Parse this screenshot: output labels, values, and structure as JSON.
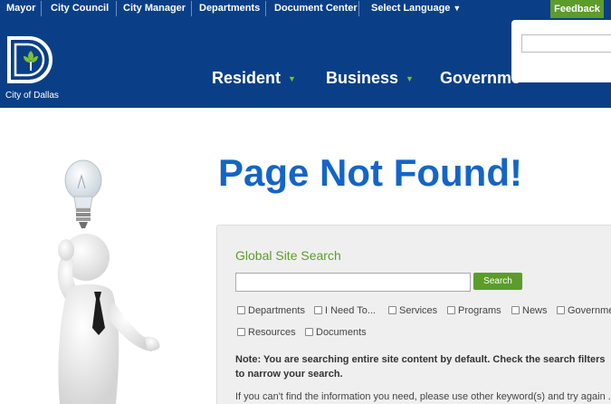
{
  "topbar": {
    "links": [
      "Mayor",
      "City Council",
      "City Manager",
      "Departments",
      "Document Center"
    ],
    "language_label": "Select Language",
    "language_caret": "▼",
    "feedback_label": "Feedback"
  },
  "header": {
    "logo_text": "City of Dallas",
    "nav": [
      {
        "label": "Resident",
        "caret": "▼"
      },
      {
        "label": "Business",
        "caret": "▼"
      },
      {
        "label": "Governme"
      }
    ],
    "search_popup_value": ""
  },
  "main": {
    "title": "Page Not Found!",
    "search": {
      "heading": "Global Site Search",
      "input_value": "",
      "button_label": "Search"
    },
    "filters": [
      "Departments",
      "I Need To...",
      "Services",
      "Programs",
      "News",
      "Governme",
      "Resources",
      "Documents"
    ],
    "note": "Note: You are searching entire site content by default. Check the search filters to narrow your search.",
    "help_text": "If you can't find the information you need, please use other keyword(s) and try again . T"
  },
  "colors": {
    "brand_blue": "#0a3f87",
    "title_blue": "#1465c7",
    "accent_green": "#5c9c2b"
  },
  "icons": {
    "logo": "city-of-dallas-d-logo-icon",
    "illustration": "person-with-lightbulb-illustration"
  }
}
